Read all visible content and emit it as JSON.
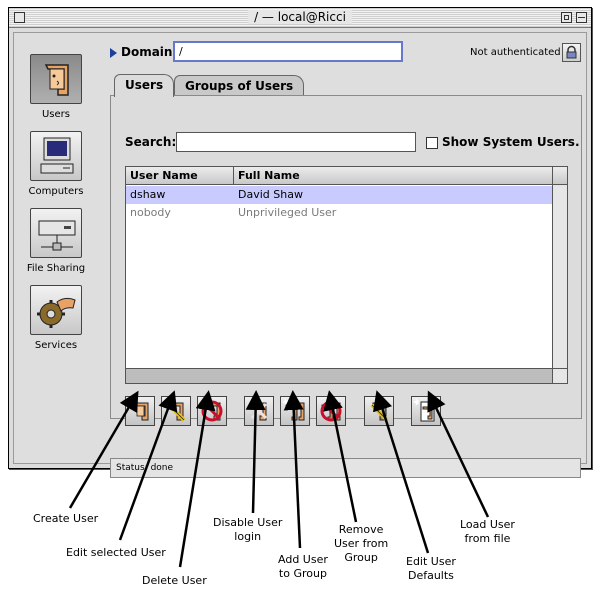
{
  "window": {
    "title": "/ — local@Ricci"
  },
  "sidebar": {
    "items": [
      {
        "label": "Users",
        "icon": "user-face-icon"
      },
      {
        "label": "Computers",
        "icon": "computer-icon"
      },
      {
        "label": "File Sharing",
        "icon": "file-server-icon"
      },
      {
        "label": "Services",
        "icon": "gear-hand-icon"
      }
    ]
  },
  "domain": {
    "label": "Domain:",
    "value": "/"
  },
  "auth": {
    "status": "Not authenticated",
    "icon": "lock-icon"
  },
  "tabs": [
    {
      "label": "Users"
    },
    {
      "label": "Groups of Users"
    }
  ],
  "search": {
    "label": "Search:",
    "value": ""
  },
  "show_system_users": {
    "label": "Show System Users.",
    "checked": false
  },
  "table": {
    "headers": [
      "User Name",
      "Full Name"
    ],
    "rows": [
      {
        "user": "dshaw",
        "full": "David Shaw",
        "selected": true
      },
      {
        "user": "nobody",
        "full": "Unprivileged User",
        "selected": false
      }
    ]
  },
  "toolbar": {
    "buttons": [
      {
        "action": "create-user",
        "icon": "new-user-icon"
      },
      {
        "action": "edit-user",
        "icon": "edit-user-icon"
      },
      {
        "action": "delete-user",
        "icon": "delete-user-icon"
      },
      {
        "action": "disable-login",
        "icon": "disable-login-icon"
      },
      {
        "action": "add-to-group",
        "icon": "add-to-group-icon"
      },
      {
        "action": "remove-from-group",
        "icon": "remove-from-group-icon"
      },
      {
        "action": "edit-defaults",
        "icon": "edit-defaults-icon"
      },
      {
        "action": "load-from-file",
        "icon": "load-file-icon"
      }
    ]
  },
  "status": {
    "text": "Status: done"
  },
  "callouts": {
    "create_user": "Create User",
    "edit_user": "Edit selected User",
    "delete_user": "Delete User",
    "disable_login_1": "Disable User",
    "disable_login_2": "login",
    "add_to_group_1": "Add User",
    "add_to_group_2": "to Group",
    "remove_group_1": "Remove",
    "remove_group_2": "User from",
    "remove_group_3": "Group",
    "edit_defaults_1": "Edit User",
    "edit_defaults_2": "Defaults",
    "load_file_1": "Load User",
    "load_file_2": "from file"
  },
  "colors": {
    "selection": "#c9cbff",
    "domain_field_border": "#6677cc",
    "accent": "#1d3f9b"
  }
}
